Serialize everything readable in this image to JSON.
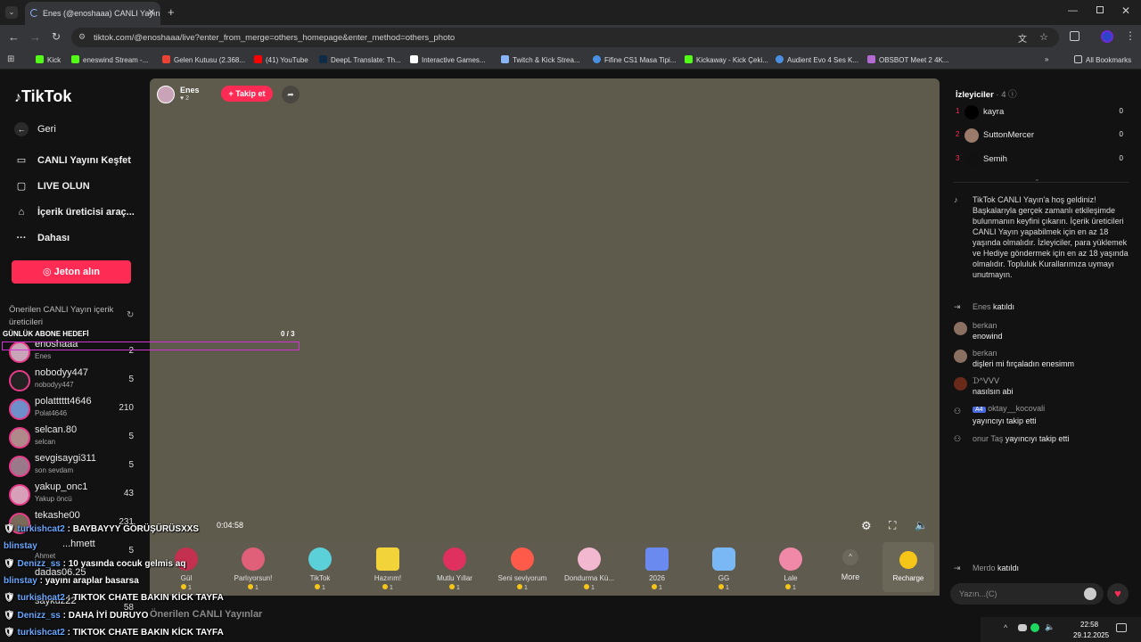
{
  "browser": {
    "tab_title": "Enes (@enoshaaa) CANLI Yayın",
    "url": "tiktok.com/@enoshaaa/live?enter_from_merge=others_homepage&enter_method=others_photo",
    "bookmarks": [
      "Kick",
      "eneswind Stream -...",
      "Gelen Kutusu (2.368...",
      "(41) YouTube",
      "DeepL Translate: Th...",
      "Interactive Games...",
      "Twitch & Kick Strea...",
      "Fifine CS1 Masa Tipi...",
      "Kickaway - Kick Çeki...",
      "Audient Evo 4 Ses K...",
      "OBSBOT Meet 2 4K..."
    ],
    "all_bookmarks": "All Bookmarks"
  },
  "sidebar": {
    "logo": "TikTok",
    "back": "Geri",
    "nav": [
      "CANLI Yayını Keşfet",
      "LIVE OLUN",
      "İçerik üreticisi araç...",
      "Dahası"
    ],
    "coin_button": "Jeton alın",
    "suggested_title": "Önerilen CANLI Yayın içerik üreticileri",
    "creators": [
      {
        "name": "enoshaaa",
        "sub": "Enes",
        "count": "2"
      },
      {
        "name": "nobodyy447",
        "sub": "nobodyy447",
        "count": "5"
      },
      {
        "name": "polatttttt4646",
        "sub": "Polat4646",
        "count": "210"
      },
      {
        "name": "selcan.80",
        "sub": "selcan",
        "count": "5"
      },
      {
        "name": "sevgisaygi311",
        "sub": "son sevdam",
        "count": "5"
      },
      {
        "name": "yakup_onc1",
        "sub": "Yakup öncü",
        "count": "43"
      },
      {
        "name": "tekashe00",
        "sub": "",
        "count": "231"
      },
      {
        "name": "...hmett",
        "sub": "Ahmet",
        "count": "5"
      },
      {
        "name": "dadas06.25",
        "sub": "",
        "count": ""
      },
      {
        "name": "saykuz22",
        "sub": "",
        "count": "58"
      }
    ]
  },
  "stream": {
    "host_name": "Enes",
    "host_likes": "2",
    "follow_button": "+ Takip et",
    "sub_goal_label": "GÜNLÜK ABONE HEDEFİ",
    "sub_goal_progress": "0 / 3",
    "timer": "0:04:58"
  },
  "gifts": [
    {
      "name": "Gül",
      "price": "1"
    },
    {
      "name": "Parlıyorsun!",
      "price": "1"
    },
    {
      "name": "TikTok",
      "price": "1"
    },
    {
      "name": "Hazırım!",
      "price": "1"
    },
    {
      "name": "Mutlu Yıllar",
      "price": "1"
    },
    {
      "name": "Seni seviyorum",
      "price": "1"
    },
    {
      "name": "Dondurma Kü...",
      "price": "1"
    },
    {
      "name": "2026",
      "price": "1"
    },
    {
      "name": "GG",
      "price": "1"
    },
    {
      "name": "Lale",
      "price": "1"
    }
  ],
  "gift_more": "More",
  "recharge": "Recharge",
  "bottom_label": "Önerilen CANLI Yayınlar",
  "viewers": {
    "title": "İzleyiciler",
    "count": "4",
    "list": [
      {
        "rank": "1",
        "name": "kayra",
        "score": "0"
      },
      {
        "rank": "2",
        "name": "SuttonMercer",
        "score": "0"
      },
      {
        "rank": "3",
        "name": "Semih",
        "score": "0"
      }
    ]
  },
  "chat": {
    "welcome": "TikTok CANLI Yayın'a hoş geldiniz! Başkalarıyla gerçek zamanlı etkileşimde bulunmanın keyfini çıkarın. İçerik üreticileri CANLI Yayın yapabilmek için en az 18 yaşında olmalıdır. İzleyiciler, para yüklemek ve Hediye göndermek için en az 18 yaşında olmalıdır. Topluluk Kurallarımıza uymayı unutmayın.",
    "messages": [
      {
        "user": "Enes",
        "text": "katıldı"
      },
      {
        "user": "berkan",
        "text": "enowind"
      },
      {
        "user": "berkan",
        "text": "dişleri mi fırçaladın enesimm"
      },
      {
        "user": "ᗪ^ᐯᐯᐯ",
        "text": "nasılsın abi"
      },
      {
        "user": "oktay__kocovali",
        "badge": "A4",
        "text": "yayıncıyı takip etti"
      },
      {
        "user": "onur Taş",
        "text": "yayıncıyı takip etti"
      },
      {
        "user": "Merdo",
        "text": "katıldı"
      }
    ],
    "input_placeholder": "Yazın...(C)"
  },
  "overlay_chat": [
    {
      "user": "turkishcat2",
      "text": "BAYBAYYY GÖRÜŞÜRÜSXXS"
    },
    {
      "user": "blinstay",
      "text": ""
    },
    {
      "user": "Denizz_ss",
      "text": "10 yasında cocuk gelmis aq"
    },
    {
      "user": "blinstay",
      "text": "yayını araplar basarsa"
    },
    {
      "user": "turkishcat2",
      "text": "TIKTOK CHATE BAKIN KİCK TAYFA"
    },
    {
      "user": "Denizz_ss",
      "text": "DAHA İYİ DURUYO"
    },
    {
      "user": "turkishcat2",
      "text": "TIKTOK CHATE BAKIN KİCK TAYFA"
    }
  ],
  "taskbar": {
    "time": "22:58",
    "date": "29.12.2025"
  },
  "colors": {
    "accent": "#fe2c55",
    "panel": "#121212",
    "video": "#5e5a4c"
  }
}
